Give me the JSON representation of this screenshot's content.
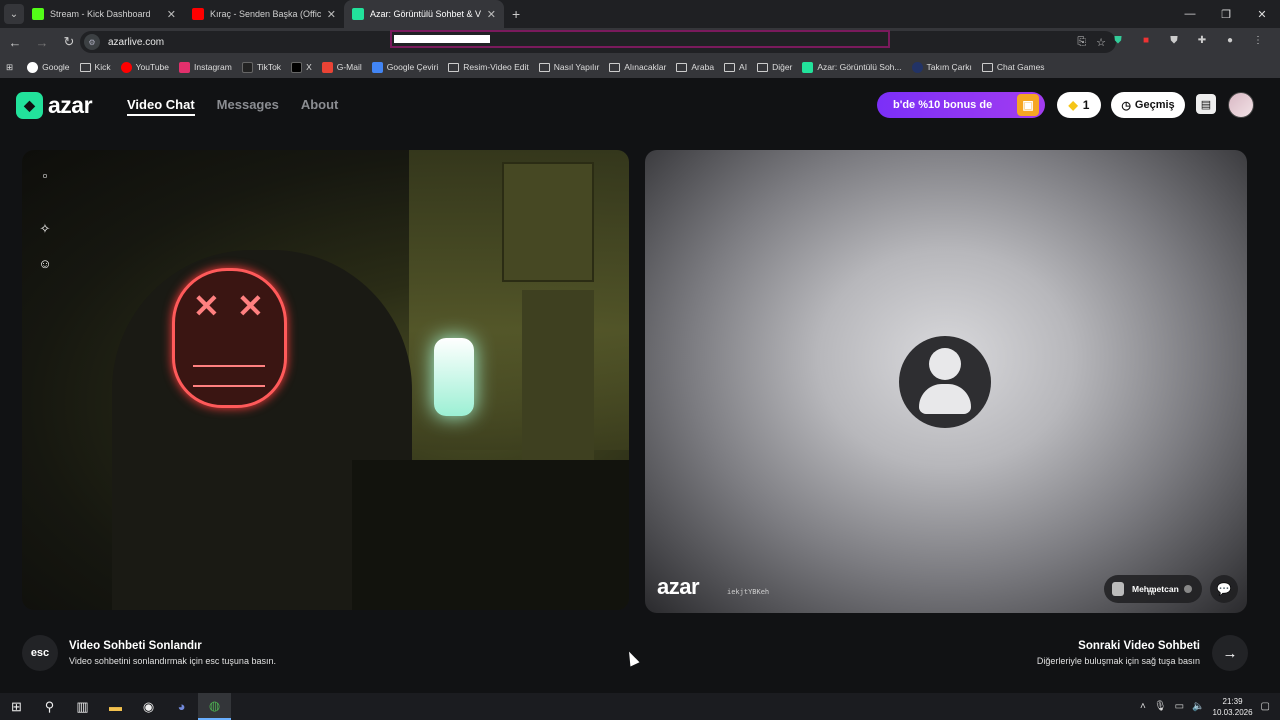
{
  "browser": {
    "tabs": [
      {
        "title": "Stream - Kick Dashboard",
        "color": "#53fc18",
        "active": false
      },
      {
        "title": "Kıraç - Senden Başka (Official V",
        "color": "#ff0000",
        "active": false
      },
      {
        "title": "Azar: Görüntülü Sohbet & V",
        "color": "#22e29b",
        "active": true
      }
    ],
    "new_tab": "+",
    "url": "azarlive.com",
    "bookmarks": [
      {
        "label": "Google",
        "type": "site",
        "color": "#ffffff"
      },
      {
        "label": "Kick",
        "type": "folder"
      },
      {
        "label": "YouTube",
        "type": "site",
        "color": "#ff0000"
      },
      {
        "label": "Instagram",
        "type": "site",
        "color": "#e1306c"
      },
      {
        "label": "TikTok",
        "type": "site",
        "color": "#111111"
      },
      {
        "label": "X",
        "type": "site",
        "color": "#000000"
      },
      {
        "label": "G-Mail",
        "type": "site",
        "color": "#ea4335"
      },
      {
        "label": "Google Çeviri",
        "type": "site",
        "color": "#4285f4"
      },
      {
        "label": "Resim-Video Edit",
        "type": "folder"
      },
      {
        "label": "Nasıl Yapılır",
        "type": "folder"
      },
      {
        "label": "Alınacaklar",
        "type": "folder"
      },
      {
        "label": "Araba",
        "type": "folder"
      },
      {
        "label": "AI",
        "type": "folder"
      },
      {
        "label": "Diğer",
        "type": "folder"
      },
      {
        "label": "Azar: Görüntülü Soh...",
        "type": "site",
        "color": "#22e29b"
      },
      {
        "label": "Takım Çarkı",
        "type": "site",
        "color": "#223366"
      },
      {
        "label": "Chat Games",
        "type": "folder"
      }
    ]
  },
  "app": {
    "logo": "azar",
    "nav": [
      {
        "label": "Video Chat",
        "active": true
      },
      {
        "label": "Messages",
        "active": false
      },
      {
        "label": "About",
        "active": false
      }
    ],
    "promo": "b'de %10 bonus de",
    "gems": "1",
    "history": "Geçmiş"
  },
  "remote": {
    "watermark": "azar",
    "watermark_id": "iekjtYBKeh",
    "peer_name": "Mehmetcan",
    "peer_country": "TR"
  },
  "footer": {
    "esc_key": "esc",
    "end_title": "Video Sohbeti Sonlandır",
    "end_subtitle": "Video sohbetini sonlandırmak için esc tuşuna basın.",
    "next_title": "Sonraki Video Sohbeti",
    "next_subtitle": "Diğerleriyle buluşmak için sağ tuşa basın"
  },
  "taskbar": {
    "time": "21:39",
    "date": "10.03.2026"
  }
}
